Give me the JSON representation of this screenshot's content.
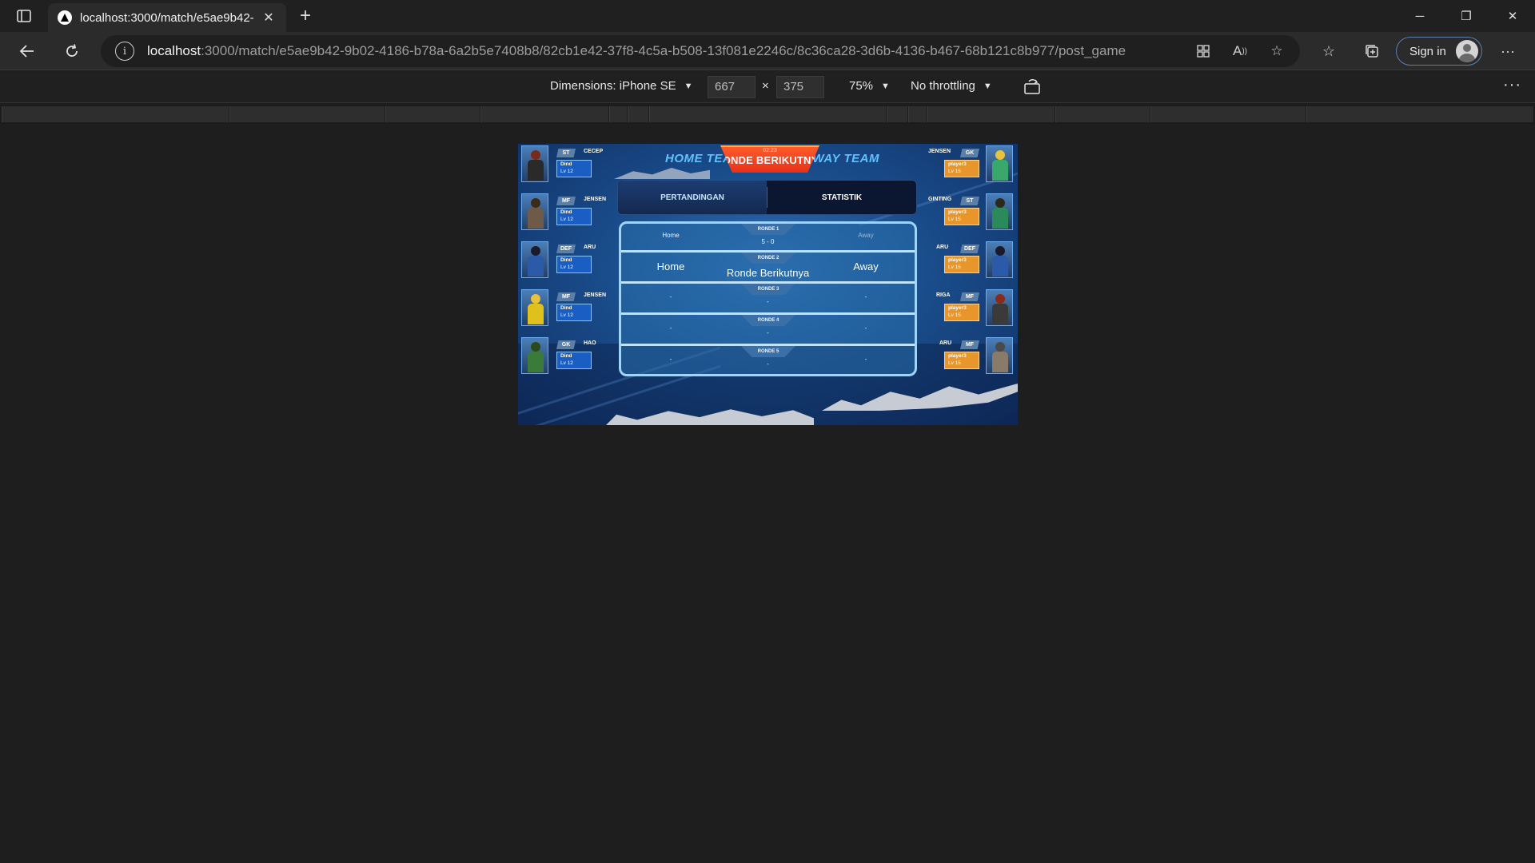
{
  "browser": {
    "tab_title": "localhost:3000/match/e5ae9b42-",
    "url_host": "localhost",
    "url_path": ":3000/match/e5ae9b42-9b02-4186-b78a-6a2b5e7408b8/82cb1e42-37f8-4c5a-b508-13f081e2246c/8c36ca28-3d6b-4136-b467-68b121c8b977/post_game",
    "sign_in_label": "Sign in"
  },
  "devtools": {
    "dimensions_label": "Dimensions: iPhone SE",
    "width_value": "667",
    "height_value": "375",
    "times": "×",
    "zoom": "75%",
    "throttling": "No throttling"
  },
  "game": {
    "home_team_title": "HOME TEAM",
    "away_team_title": "AWAY TEAM",
    "banner_time": "02:23",
    "banner_text": "RONDE BERIKUTNYA",
    "tabs": [
      {
        "label": "PERTANDINGAN",
        "active": true
      },
      {
        "label": "STATISTIK",
        "active": false
      }
    ],
    "rounds": [
      {
        "tag": "RONDE 1",
        "score": "5 - 0",
        "home": "Home",
        "away": "Away"
      },
      {
        "tag": "RONDE 2",
        "score": "Ronde Berikutnya",
        "home": "Home",
        "away": "Away"
      },
      {
        "tag": "RONDE 3",
        "score": "-",
        "home": "-",
        "away": "-"
      },
      {
        "tag": "RONDE 4",
        "score": "-",
        "home": "-",
        "away": "-"
      },
      {
        "tag": "RONDE 5",
        "score": "-",
        "home": "-",
        "away": "-"
      }
    ],
    "home_players": [
      {
        "position": "ST",
        "name": "CECEP",
        "owner": "Dind",
        "level": "Lv 12",
        "hair": "#7a2a1a",
        "shirt": "#2a2a2a"
      },
      {
        "position": "MF",
        "name": "JENSEN",
        "owner": "Dind",
        "level": "Lv 12",
        "hair": "#3a2a1a",
        "shirt": "#6d5a48"
      },
      {
        "position": "DEF",
        "name": "ARU",
        "owner": "Dind",
        "level": "Lv 12",
        "hair": "#1a1a2a",
        "shirt": "#2b5aa8"
      },
      {
        "position": "MF",
        "name": "JENSEN",
        "owner": "Dind",
        "level": "Lv 12",
        "hair": "#e8c23a",
        "shirt": "#e0c01a"
      },
      {
        "position": "GK",
        "name": "HAO",
        "owner": "Dind",
        "level": "Lv 12",
        "hair": "#2a4a1a",
        "shirt": "#3a7a3a"
      }
    ],
    "away_players": [
      {
        "position": "GK",
        "name": "JENSEN",
        "owner": "player3",
        "level": "Lv 15",
        "hair": "#e8c23a",
        "shirt": "#3aa86a"
      },
      {
        "position": "ST",
        "name": "GINTING",
        "owner": "player3",
        "level": "Lv 15",
        "hair": "#2a2a1a",
        "shirt": "#2a8a5a"
      },
      {
        "position": "DEF",
        "name": "ARU",
        "owner": "player3",
        "level": "Lv 15",
        "hair": "#1a1a2a",
        "shirt": "#2b5aa8"
      },
      {
        "position": "MF",
        "name": "RIGA",
        "owner": "player3",
        "level": "Lv 15",
        "hair": "#8a2a1a",
        "shirt": "#3a3a3a"
      },
      {
        "position": "MF",
        "name": "ARU",
        "owner": "player3",
        "level": "Lv 15",
        "hair": "#4a4a4a",
        "shirt": "#8a7a6a"
      }
    ]
  }
}
